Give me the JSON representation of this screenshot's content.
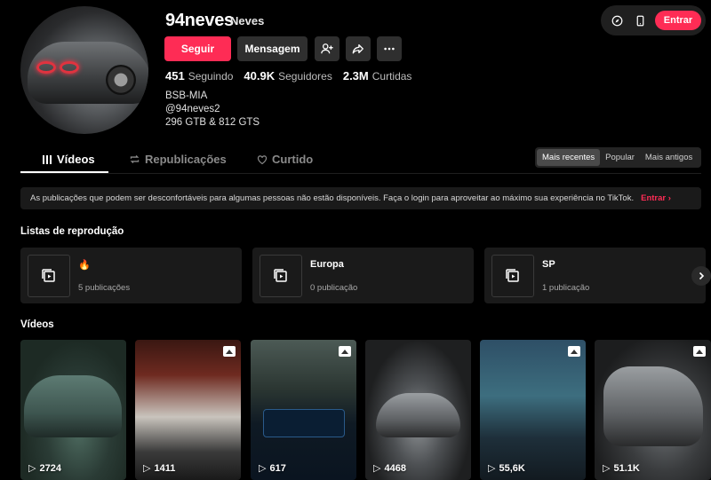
{
  "profile": {
    "username": "94neves",
    "nickname": "Neves",
    "follow_label": "Seguir",
    "message_label": "Mensagem",
    "stats": [
      {
        "value": "451",
        "label": "Seguindo"
      },
      {
        "value": "40.9K",
        "label": "Seguidores"
      },
      {
        "value": "2.3M",
        "label": "Curtidas"
      }
    ],
    "bio": [
      "BSB-MIA",
      "@94neves2",
      "296 GTB & 812 GTS"
    ]
  },
  "topbar": {
    "login_label": "Entrar",
    "icons": [
      "compass-icon",
      "phone-icon"
    ]
  },
  "tabs": [
    {
      "label": "Vídeos",
      "active": true
    },
    {
      "label": "Republicações",
      "active": false
    },
    {
      "label": "Curtido",
      "active": false
    }
  ],
  "sort": {
    "options": [
      "Mais recentes",
      "Popular",
      "Mais antigos"
    ],
    "selected": "Mais recentes"
  },
  "banner": {
    "text": "As publicações que podem ser desconfortáveis para algumas pessoas não estão disponíveis. Faça o login para aproveitar ao máximo sua experiência no TikTok.",
    "link": "Entrar"
  },
  "playlists_title": "Listas de reprodução",
  "playlists": [
    {
      "name": "🔥",
      "count": "5 publicações"
    },
    {
      "name": "Europa",
      "count": "0 publicação"
    },
    {
      "name": "SP",
      "count": "1 publicação"
    }
  ],
  "videos_title": "Vídeos",
  "videos": [
    {
      "views": "2724",
      "photo_badge": false
    },
    {
      "views": "1411",
      "photo_badge": true
    },
    {
      "views": "617",
      "photo_badge": true
    },
    {
      "views": "4468",
      "photo_badge": false
    },
    {
      "views": "55,6K",
      "photo_badge": true
    },
    {
      "views": "51.1K",
      "photo_badge": true
    }
  ],
  "colors": {
    "accent": "#fe2c55",
    "background": "#000000",
    "surface": "#1a1a1a"
  }
}
